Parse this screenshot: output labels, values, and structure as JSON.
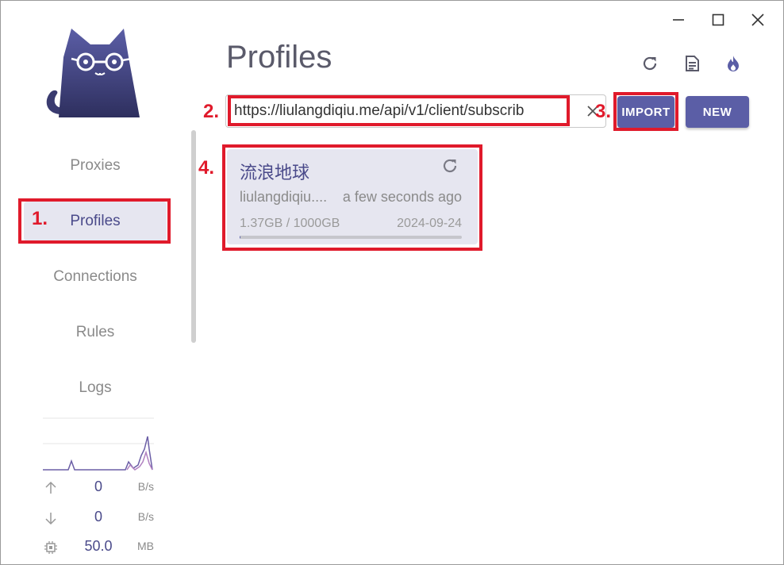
{
  "window": {
    "controls": [
      "minimize",
      "maximize",
      "close"
    ]
  },
  "sidebar": {
    "nav": [
      {
        "label": "Proxies"
      },
      {
        "label": "Profiles"
      },
      {
        "label": "Connections"
      },
      {
        "label": "Rules"
      },
      {
        "label": "Logs"
      }
    ],
    "active": "Profiles",
    "stats": {
      "upload": {
        "value": "0",
        "unit": "B/s"
      },
      "download": {
        "value": "0",
        "unit": "B/s"
      },
      "memory": {
        "value": "50.0",
        "unit": "MB"
      }
    }
  },
  "main": {
    "title": "Profiles",
    "toolbar_icons": [
      "refresh-icon",
      "log-document-icon",
      "fire-icon"
    ],
    "url_input": {
      "value": "https://liulangdiqiu.me/api/v1/client/subscrib",
      "clear_icon": "close-icon"
    },
    "import_label": "IMPORT",
    "new_label": "NEW",
    "profile": {
      "name": "流浪地球",
      "url": "liulangdiqiu....",
      "updated": "a few seconds ago",
      "usage": "1.37GB / 1000GB",
      "expire": "2024-09-24",
      "usage_fraction": 0.00137
    }
  },
  "annotations": [
    "1.",
    "2.",
    "3.",
    "4."
  ],
  "colors": {
    "accent": "#5b5ea6",
    "active_bg": "#e6e6f0",
    "annotation": "#e01a2b"
  }
}
